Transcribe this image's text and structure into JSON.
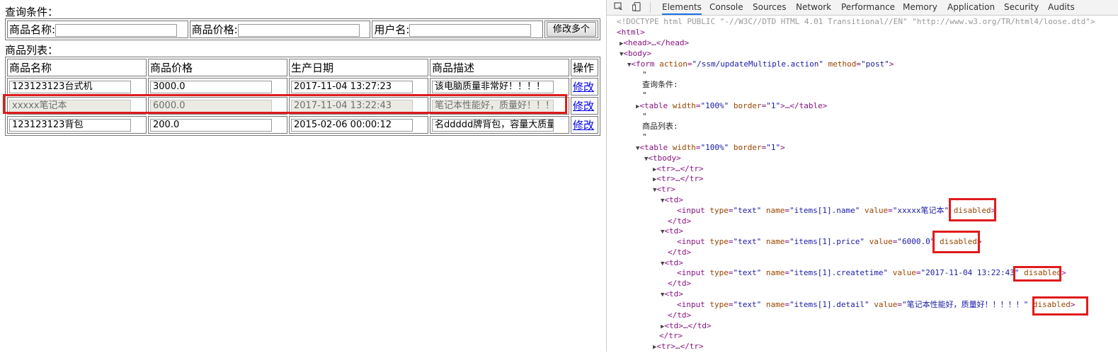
{
  "webpage": {
    "query_label": "查询条件：",
    "query_fields": [
      {
        "label": "商品名称:",
        "value": ""
      },
      {
        "label": "商品价格:",
        "value": ""
      },
      {
        "label": "用户名:",
        "value": ""
      }
    ],
    "modify_button": "修改多个",
    "list_label": "商品列表：",
    "columns": [
      "商品名称",
      "商品价格",
      "生产日期",
      "商品描述",
      "操作"
    ],
    "rows": [
      {
        "name": "123123123台式机",
        "price": "3000.0",
        "date": "2017-11-04 13:27:23",
        "detail": "该电脑质量非常好！！！！",
        "action": "修改",
        "disabled": false
      },
      {
        "name": "xxxxx笔记本",
        "price": "6000.0",
        "date": "2017-11-04 13:22:43",
        "detail": "笔记本性能好，质量好！！！",
        "action": "修改",
        "disabled": true
      },
      {
        "name": "123123123背包",
        "price": "200.0",
        "date": "2015-02-06 00:00:12",
        "detail": "名ddddd牌背包，容量大质量",
        "action": "修改",
        "disabled": false
      }
    ],
    "highlight_color": "#e01b1b"
  },
  "devtools": {
    "tabs": [
      "Elements",
      "Console",
      "Sources",
      "Network",
      "Performance",
      "Memory",
      "Application",
      "Security",
      "Audits"
    ],
    "active_tab": "Elements",
    "icons": [
      "inspect-icon",
      "device-toolbar-icon"
    ],
    "code": {
      "doctype": "<!DOCTYPE html PUBLIC \"-//W3C//DTD HTML 4.01 Transitional//EN\" \"http://www.w3.org/TR/html4/loose.dtd\">",
      "html_open": "<html>",
      "head": "<head>…</head>",
      "body_open": "<body>",
      "form_tag": "form",
      "form_attrs": [
        {
          "name": "action",
          "value": "\"/ssm/updateMultiple.action\""
        },
        {
          "name": "method",
          "value": "\"post\""
        }
      ],
      "quote": "\"",
      "text_query": "查询条件:",
      "table1_tag": "table",
      "table_attrs": [
        {
          "name": "width",
          "value": "\"100%\""
        },
        {
          "name": "border",
          "value": "\"1\""
        }
      ],
      "table1_close": ">…</table>",
      "text_list": "商品列表:",
      "tbody": "<tbody>",
      "tr_collapsed": "<tr>…</tr>",
      "tr_open": "<tr>",
      "td_open": "<td>",
      "td_close": "</td>",
      "td_collapsed": "<td>…</td>",
      "tr_close": "</tr>",
      "input_lines": [
        {
          "name_val": "\"items[1].name\"",
          "value_val": "\"xxxxx笔记本\"",
          "flag": "disabled"
        },
        {
          "name_val": "\"items[1].price\"",
          "value_val": "\"6000.0\"",
          "flag": "disabled"
        },
        {
          "name_val": "\"items[1].createtime\"",
          "value_val": "\"2017-11-04 13:22:43\"",
          "flag": "disabled"
        },
        {
          "name_val": "\"items[1].detail\"",
          "value_val": "\"笔记本性能好，质量好！！！！！\"",
          "flag": "disabled"
        }
      ],
      "input_type_val": "\"text\""
    }
  }
}
